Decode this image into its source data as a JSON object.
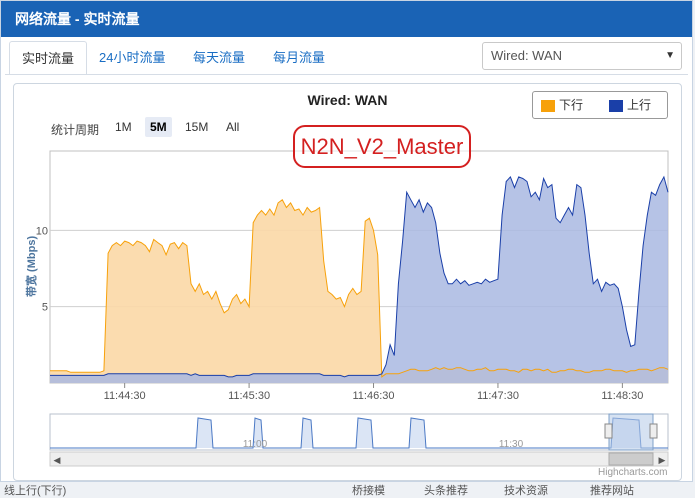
{
  "window": {
    "title": "网络流量 - 实时流量"
  },
  "tabs": [
    {
      "label": "实时流量",
      "active": true
    },
    {
      "label": "24小时流量",
      "active": false
    },
    {
      "label": "每天流量",
      "active": false
    },
    {
      "label": "每月流量",
      "active": false
    }
  ],
  "interface_select": {
    "value": "Wired: WAN"
  },
  "range_selector": {
    "label": "统计周期",
    "buttons": [
      "1M",
      "5M",
      "15M",
      "All"
    ],
    "selected": "5M"
  },
  "watermark": "N2N_V2_Master",
  "credit": "Highcharts.com",
  "footer": {
    "items": [
      "线上行(下行)",
      "桥接模",
      "头条推荐",
      "技术资源",
      "推荐网站"
    ]
  },
  "colors": {
    "download": "#f7a10a",
    "upload": "#1a3fa8",
    "download_fill": "#fbd8a6",
    "upload_fill": "#a9b8e2"
  },
  "chart_data": {
    "type": "area",
    "title": "Wired: WAN",
    "ylabel": "带宽 (Mbps)",
    "ylim": [
      0,
      15.2
    ],
    "yticks": [
      5,
      10
    ],
    "xticks": [
      "11:44:30",
      "11:45:30",
      "11:46:30",
      "11:47:30",
      "11:48:30"
    ],
    "grid": true,
    "legend": "top-right",
    "navigator_labels": [
      "11:00",
      "11:30"
    ],
    "x_seconds": [
      0,
      2,
      4,
      6,
      8,
      10,
      12,
      14,
      16,
      18,
      20,
      22,
      24,
      26,
      28,
      30,
      32,
      34,
      36,
      38,
      40,
      42,
      44,
      46,
      48,
      50,
      52,
      54,
      56,
      58,
      60,
      62,
      64,
      66,
      68,
      70,
      72,
      74,
      76,
      78,
      80,
      82,
      84,
      86,
      88,
      90,
      92,
      94,
      96,
      98,
      100,
      102,
      104,
      106,
      108,
      110,
      112,
      114,
      116,
      118,
      120,
      122,
      124,
      126,
      128,
      130,
      132,
      134,
      136,
      138,
      140,
      142,
      144,
      146,
      148,
      150,
      152,
      154,
      156,
      158,
      160,
      162,
      164,
      166,
      168,
      170,
      172,
      174,
      176,
      178,
      180,
      182,
      184,
      186,
      188,
      190,
      192,
      194,
      196,
      198,
      200,
      202,
      204,
      206,
      208,
      210,
      212,
      214,
      216,
      218,
      220,
      222,
      224,
      226,
      228,
      230,
      232,
      234,
      236,
      238,
      240,
      242,
      244,
      246,
      248,
      250,
      252,
      254,
      256,
      258,
      260,
      262,
      264,
      266,
      268,
      270,
      272,
      274,
      276,
      278,
      280,
      282,
      284,
      286,
      288,
      290,
      292,
      294,
      296,
      298
    ],
    "series": [
      {
        "name": "下行",
        "values": [
          0.8,
          0.8,
          0.8,
          0.8,
          0.8,
          0.7,
          0.7,
          0.7,
          0.7,
          0.7,
          0.7,
          0.7,
          0.7,
          0.8,
          8.5,
          9.0,
          9.2,
          9.0,
          9.3,
          9.2,
          9.0,
          9.3,
          9.2,
          9.0,
          8.6,
          9.4,
          9.2,
          9.0,
          8.4,
          9.1,
          9.2,
          8.8,
          9.2,
          9.0,
          6.5,
          6.0,
          6.5,
          5.8,
          6.0,
          5.5,
          6.0,
          5.2,
          4.6,
          4.8,
          5.5,
          5.8,
          5.2,
          5.5,
          5.0,
          10.5,
          11.0,
          11.3,
          11.0,
          11.4,
          11.0,
          11.8,
          12.0,
          11.5,
          11.8,
          11.3,
          11.4,
          11.0,
          11.5,
          11.2,
          11.3,
          11.5,
          8.0,
          6.0,
          5.8,
          5.5,
          5.6,
          5.0,
          5.8,
          6.2,
          5.8,
          6.0,
          10.6,
          10.8,
          10.0,
          8.4,
          0.4,
          0.6,
          0.6,
          0.6,
          0.6,
          0.7,
          0.8,
          0.9,
          0.9,
          0.8,
          0.8,
          0.8,
          0.9,
          1.0,
          0.9,
          1.0,
          0.9,
          0.9,
          1.0,
          1.0,
          0.9,
          0.8,
          0.8,
          0.9,
          0.9,
          1.0,
          0.8,
          0.8,
          0.9,
          0.9,
          0.9,
          0.8,
          0.8,
          0.7,
          0.9,
          0.9,
          0.8,
          0.9,
          0.9,
          0.8,
          0.9,
          0.7,
          0.7,
          0.8,
          0.8,
          0.9,
          0.9,
          0.8,
          0.8,
          0.7,
          0.7,
          0.8,
          0.8,
          0.8,
          0.9,
          0.9,
          0.8,
          0.8,
          0.8,
          0.7,
          0.8,
          0.8,
          0.9,
          0.9,
          0.9,
          0.8,
          0.9,
          1.0,
          1.0,
          0.9
        ]
      },
      {
        "name": "上行",
        "values": [
          0.5,
          0.5,
          0.5,
          0.5,
          0.5,
          0.5,
          0.5,
          0.5,
          0.5,
          0.5,
          0.5,
          0.5,
          0.5,
          0.5,
          0.6,
          0.6,
          0.6,
          0.6,
          0.6,
          0.6,
          0.6,
          0.6,
          0.6,
          0.6,
          0.6,
          0.6,
          0.6,
          0.6,
          0.6,
          0.6,
          0.6,
          0.6,
          0.6,
          0.6,
          0.5,
          0.6,
          0.5,
          0.5,
          0.5,
          0.5,
          0.5,
          0.5,
          0.5,
          0.4,
          0.4,
          0.5,
          0.5,
          0.5,
          0.5,
          0.6,
          0.6,
          0.6,
          0.6,
          0.6,
          0.6,
          0.6,
          0.6,
          0.6,
          0.6,
          0.6,
          0.6,
          0.6,
          0.6,
          0.6,
          0.6,
          0.6,
          0.5,
          0.5,
          0.5,
          0.5,
          0.5,
          0.4,
          0.5,
          0.5,
          0.5,
          0.5,
          0.5,
          0.5,
          0.5,
          0.5,
          0.6,
          1.2,
          2.5,
          1.8,
          6.5,
          9.3,
          12.5,
          12.0,
          11.5,
          12.0,
          11.2,
          11.8,
          11.5,
          10.5,
          8.5,
          7.2,
          6.5,
          6.5,
          6.8,
          6.5,
          6.7,
          6.4,
          6.5,
          6.6,
          6.5,
          6.8,
          6.6,
          6.7,
          6.8,
          11.0,
          13.2,
          13.5,
          12.8,
          13.5,
          13.4,
          13.2,
          12.2,
          12.5,
          12.0,
          13.4,
          12.8,
          13.0,
          10.8,
          10.5,
          11.0,
          11.5,
          11.0,
          13.0,
          12.8,
          11.0,
          8.5,
          6.5,
          6.8,
          6.0,
          6.6,
          6.4,
          6.5,
          6.2,
          5.0,
          3.5,
          2.4,
          2.5,
          6.0,
          9.0,
          11.0,
          12.5,
          12.3,
          13.0,
          13.5,
          12.5
        ]
      }
    ]
  }
}
